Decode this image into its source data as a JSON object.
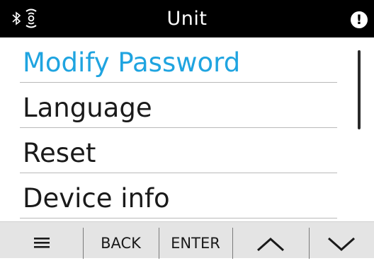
{
  "header": {
    "title": "Unit",
    "icons": [
      "bluetooth-icon",
      "wireless-icon",
      "alert-icon"
    ],
    "alert_glyph": "!"
  },
  "menu": {
    "items": [
      {
        "label": "Modify Password",
        "selected": true
      },
      {
        "label": "Language",
        "selected": false
      },
      {
        "label": "Reset",
        "selected": false
      },
      {
        "label": "Device info",
        "selected": false
      }
    ]
  },
  "softkeys": {
    "menu_icon": "hamburger-menu-icon",
    "back_label": "BACK",
    "enter_label": "ENTER",
    "up_icon": "chevron-up-icon",
    "down_icon": "chevron-down-icon"
  },
  "colors": {
    "accent": "#1fa4e0",
    "header_bg": "#000000",
    "softkey_bg": "#e4e4e4",
    "text": "#1a1a1a"
  }
}
